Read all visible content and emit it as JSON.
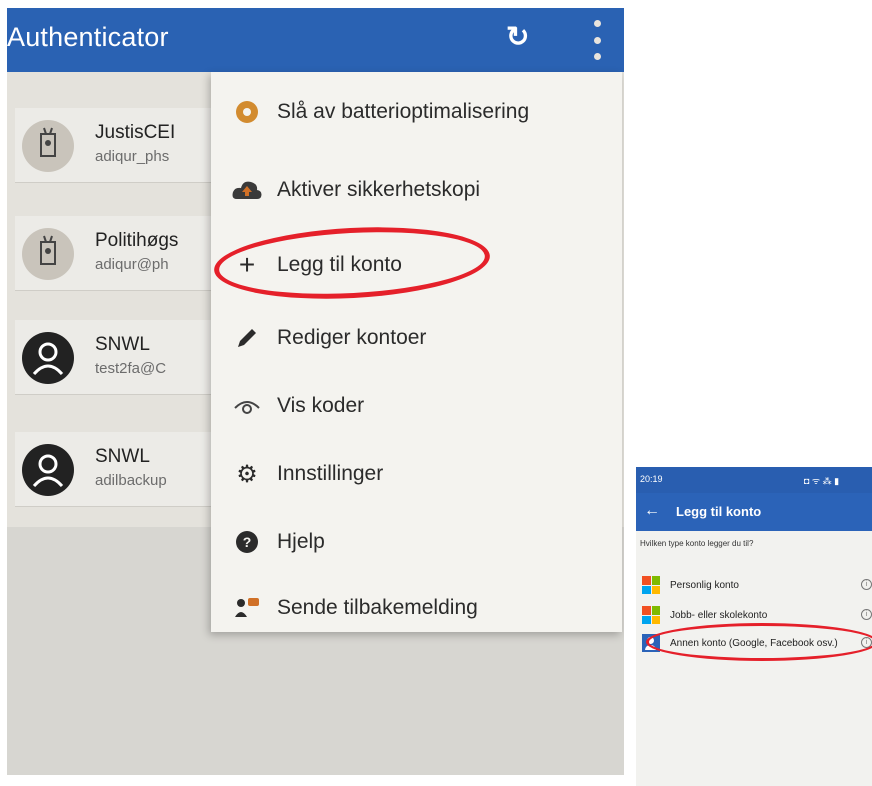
{
  "left_screen": {
    "app_bar": {
      "title": "Authenticator",
      "refresh_icon": "refresh-icon",
      "more_icon": "more-vert-icon",
      "color": "#2a62b3"
    },
    "accounts": [
      {
        "name": "JustisCEI",
        "email": "adiqur_phs",
        "icon": "badge-icon"
      },
      {
        "name": "Politihøgs",
        "email": "adiqur@ph",
        "icon": "badge-icon"
      },
      {
        "name": "SNWL",
        "email": "test2fa@C",
        "icon": "person-icon"
      },
      {
        "name": "SNWL",
        "email": "adilbackup",
        "icon": "person-icon"
      }
    ],
    "menu": [
      {
        "label": "Slå av batterioptimalisering",
        "icon": "battery-gear-icon"
      },
      {
        "label": "Aktiver sikkerhetskopi",
        "icon": "cloud-upload-icon"
      },
      {
        "label": "Legg til konto",
        "icon": "plus-icon",
        "highlighted": true
      },
      {
        "label": "Rediger kontoer",
        "icon": "pencil-icon"
      },
      {
        "label": "Vis koder",
        "icon": "eye-icon"
      },
      {
        "label": "Innstillinger",
        "icon": "gear-icon"
      },
      {
        "label": "Hjelp",
        "icon": "help-icon"
      },
      {
        "label": "Sende tilbakemelding",
        "icon": "feedback-icon"
      }
    ],
    "highlight_color": "#e5202a"
  },
  "right_screen": {
    "status_bar": {
      "time": "20:19",
      "right": "◘ ᯤ ⁂ ▮"
    },
    "app_bar": {
      "title": "Legg til konto",
      "back_icon": "back-arrow-icon"
    },
    "question": "Hvilken type konto legger du til?",
    "options": [
      {
        "label": "Personlig konto",
        "icon": "microsoft-logo-icon"
      },
      {
        "label": "Jobb- eller skolekonto",
        "icon": "microsoft-logo-icon"
      },
      {
        "label": "Annen konto (Google, Facebook osv.)",
        "icon": "person-key-icon",
        "highlighted": true
      }
    ],
    "info_icon": "info-icon",
    "ms_colors": [
      "#f25022",
      "#7fba00",
      "#00a4ef",
      "#ffb900"
    ]
  }
}
